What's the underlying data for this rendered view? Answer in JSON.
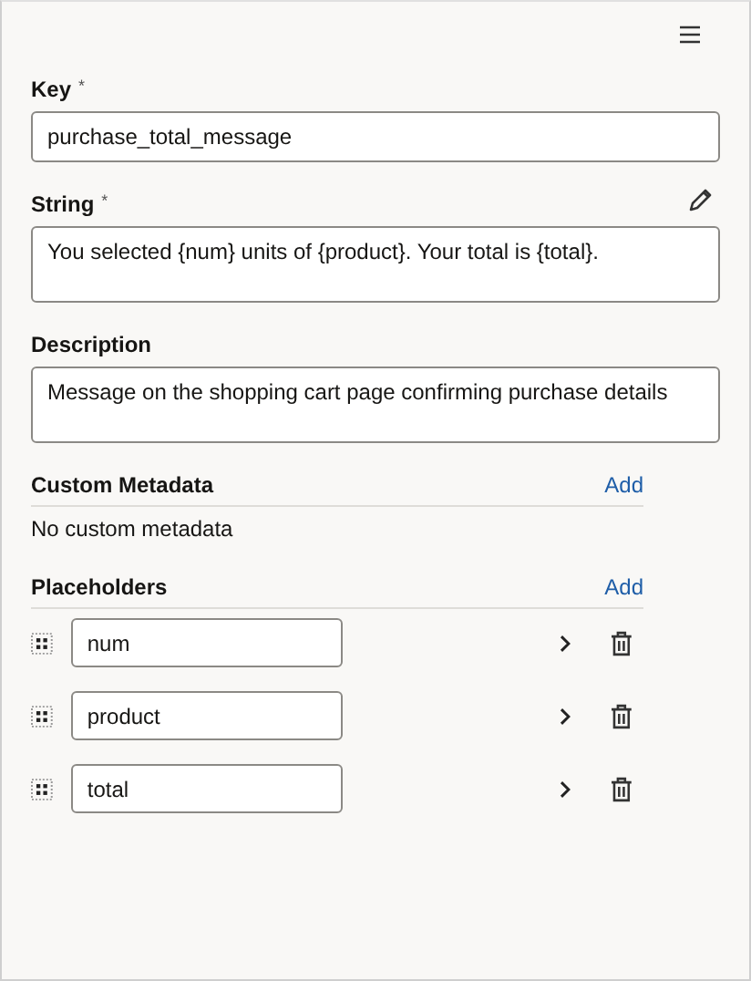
{
  "fields": [
    {
      "label": "Key",
      "required_mark": "*",
      "value": "purchase_total_message",
      "kind": "input",
      "editable_icon": false
    },
    {
      "label": "String",
      "required_mark": "*",
      "value": "You selected {num} units of {product}. Your total is {total}.",
      "kind": "textarea",
      "editable_icon": true
    },
    {
      "label": "Description",
      "value": "Message on the shopping cart page confirming purchase details",
      "kind": "textarea",
      "editable_icon": false
    }
  ],
  "custom_metadata": {
    "title": "Custom Metadata",
    "action": "Add",
    "empty_text": "No custom metadata"
  },
  "placeholders": {
    "title": "Placeholders",
    "action": "Add",
    "items": [
      {
        "value": "num"
      },
      {
        "value": "product"
      },
      {
        "value": "total"
      }
    ]
  }
}
